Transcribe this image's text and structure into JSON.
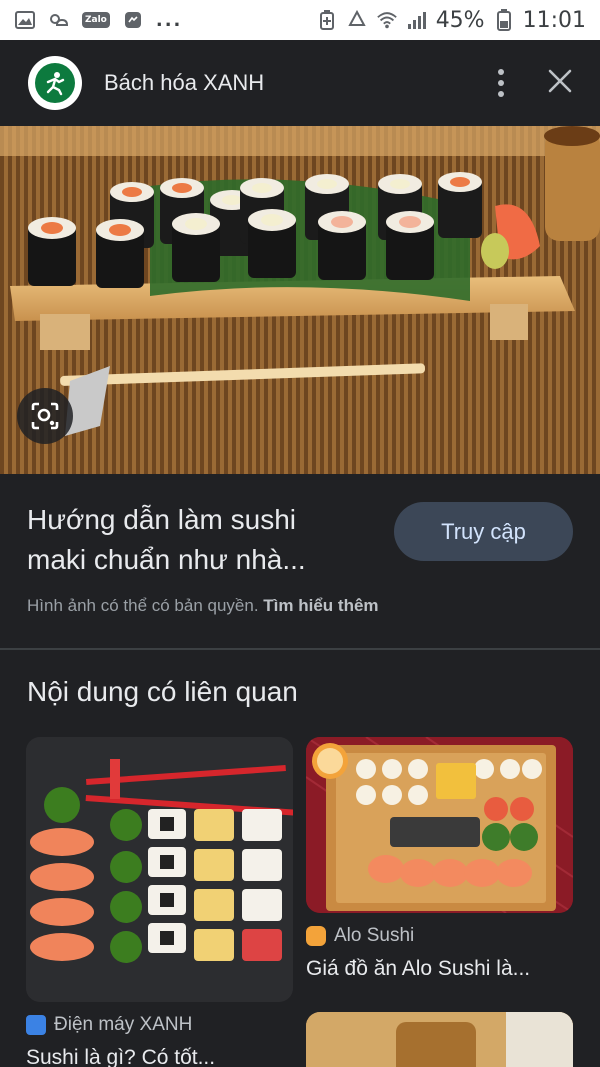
{
  "status_bar": {
    "zalo": "Zalo",
    "more": "...",
    "battery": "45%",
    "time": "11:01"
  },
  "header": {
    "site_name": "Bách hóa XANH"
  },
  "result": {
    "title": "Hướng dẫn làm sushi maki chuẩn như nhà...",
    "visit_label": "Truy cập",
    "copyright_text": "Hình ảnh có thể có bản quyền.",
    "learn_more": "Tìm hiểu thêm"
  },
  "related": {
    "heading": "Nội dung có liên quan",
    "cards": [
      {
        "source": "Điện máy XANH",
        "title": "Sushi là gì? Có tốt..."
      },
      {
        "source": "Alo Sushi",
        "title": "Giá đồ ăn Alo Sushi là..."
      }
    ]
  },
  "colors": {
    "background": "#202124",
    "button_bg": "#3c4757",
    "button_text": "#d2e3fc",
    "brand_green": "#0d7a3e"
  }
}
